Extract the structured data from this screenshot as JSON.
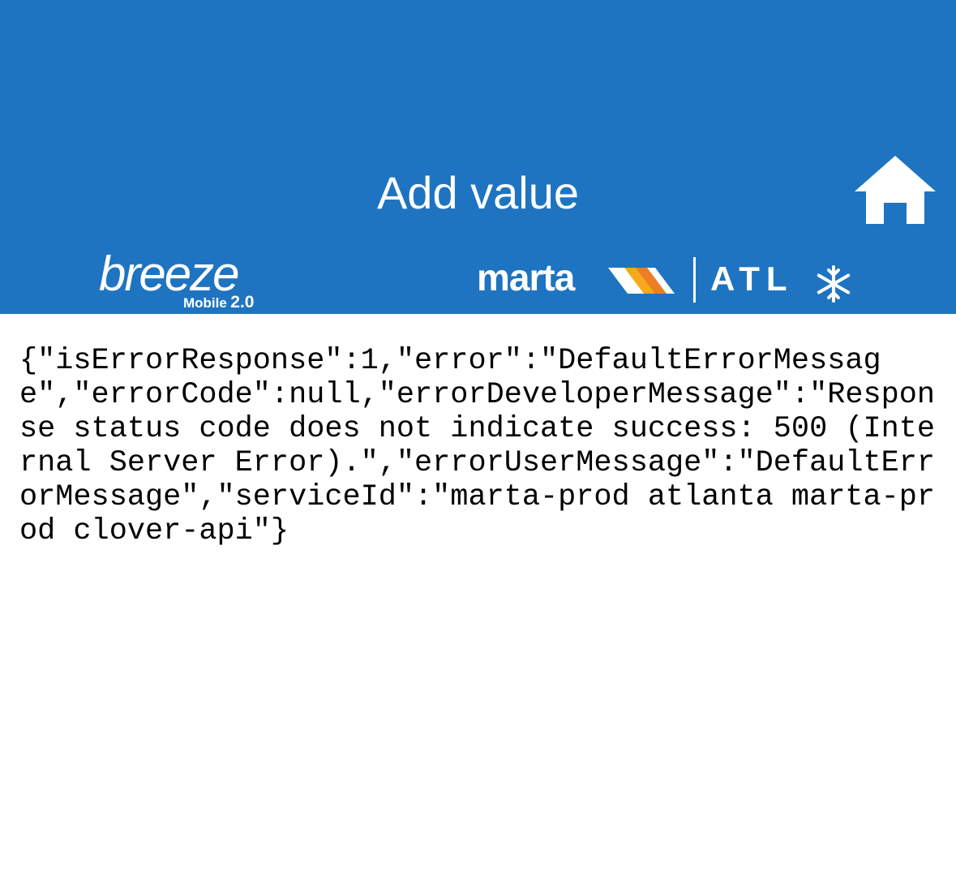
{
  "header": {
    "title": "Add value",
    "background_color": "#1e74c0",
    "home_icon": "home-icon"
  },
  "logos": {
    "breeze": {
      "wordmark": "breeze",
      "subtitle_label": "Mobile",
      "subtitle_version": "2.0"
    },
    "marta": {
      "wordmark": "marta",
      "stripe_colors": [
        "#ffffff",
        "#f7a81b",
        "#1e74c0"
      ]
    },
    "atl": {
      "wordmark": "ATL",
      "icon": "snowflake-icon"
    }
  },
  "error": {
    "message": "{\"isErrorResponse\":1,\"error\":\"DefaultErrorMessage\",\"errorCode\":null,\"errorDeveloperMessage\":\"Response status code does not indicate success: 500 (Internal Server Error).\",\"errorUserMessage\":\"DefaultErrorMessage\",\"serviceId\":\"marta-prod atlanta marta-prod clover-api\"}"
  }
}
